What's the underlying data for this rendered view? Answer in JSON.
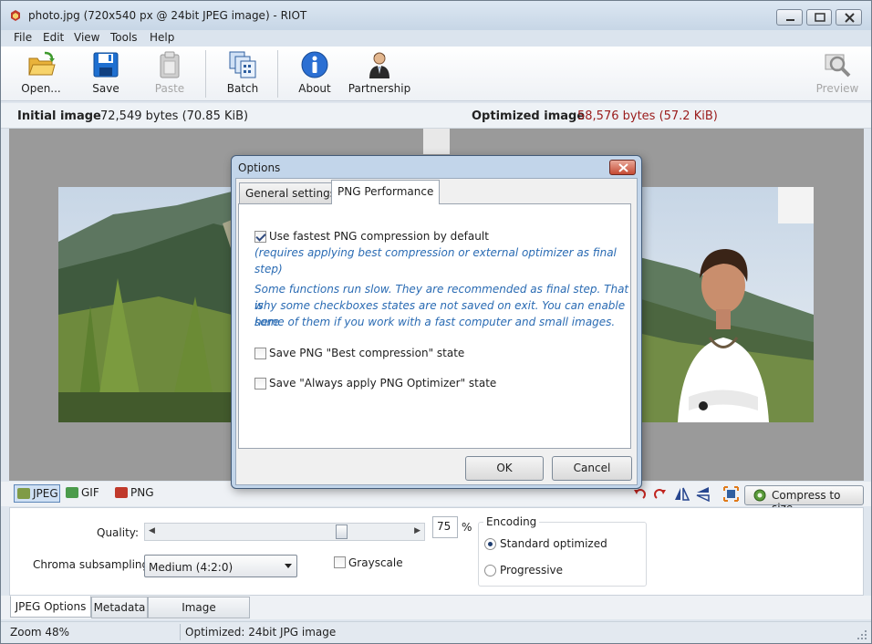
{
  "window": {
    "title": "photo.jpg (720x540 px @ 24bit JPEG image) - RIOT"
  },
  "menu": [
    "File",
    "Edit",
    "View",
    "Tools",
    "Help"
  ],
  "toolbar": {
    "open": "Open...",
    "save": "Save",
    "paste": "Paste",
    "batch": "Batch",
    "about": "About",
    "partnership": "Partnership",
    "preview": "Preview"
  },
  "info": {
    "initial_label": "Initial image",
    "initial_value": "72,549 bytes (70.85 KiB)",
    "optimized_label": "Optimized image",
    "optimized_value": "58,576 bytes (57.2 KiB)"
  },
  "formats": {
    "jpeg": "JPEG",
    "gif": "GIF",
    "png": "PNG",
    "compress_to_size": "Compress to size"
  },
  "jpeg_options": {
    "quality_label": "Quality:",
    "quality_value": "75",
    "quality_unit": "%",
    "chroma_label": "Chroma subsampling:",
    "chroma_value": "Medium (4:2:0)",
    "grayscale_label": "Grayscale",
    "encoding_title": "Encoding",
    "encoding_standard": "Standard optimized",
    "encoding_progressive": "Progressive"
  },
  "bottom_tabs": [
    "JPEG Options",
    "Metadata",
    "Image adjustments"
  ],
  "status": {
    "zoom": "Zoom 48%",
    "optimized": "Optimized: 24bit JPG image"
  },
  "dialog": {
    "title": "Options",
    "tab_general": "General settings",
    "tab_png": "PNG Performance",
    "fastest_label": "Use fastest PNG compression by default",
    "fastest_note": "(requires applying best compression or external optimizer as final step)",
    "slow_note_1": "Some functions run slow. They are recommended as final step. That is",
    "slow_note_2": "why some checkboxes states are not saved on exit. You can enable here",
    "slow_note_3": "some of them if you work with a fast computer and small images.",
    "save_best_label": "Save PNG \"Best compression\" state",
    "save_optimizer_label": "Save \"Always apply PNG Optimizer\" state",
    "ok": "OK",
    "cancel": "Cancel"
  }
}
